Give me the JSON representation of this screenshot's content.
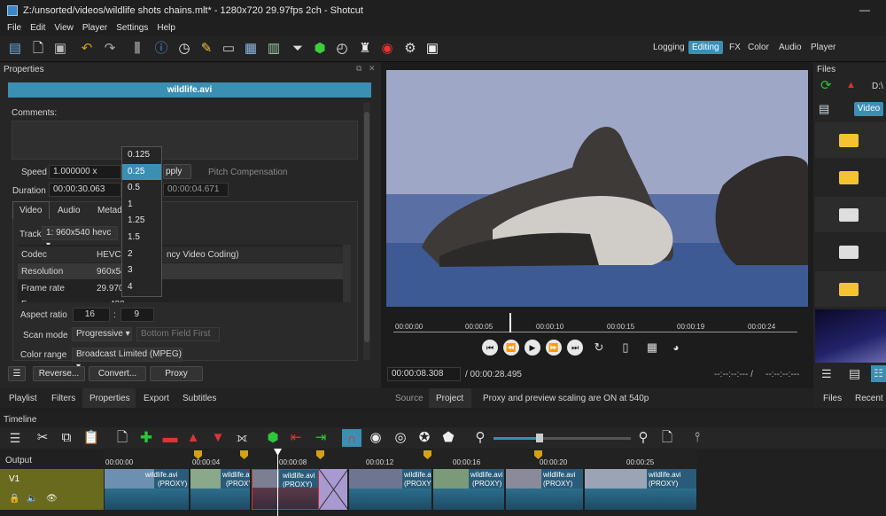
{
  "window": {
    "title": "Z:/unsorted/videos/wildlife shots chains.mlt* - 1280x720 29.97fps 2ch - Shotcut"
  },
  "menu": [
    "File",
    "Edit",
    "View",
    "Player",
    "Settings",
    "Help"
  ],
  "layouts": {
    "logging": "Logging",
    "editing": "Editing",
    "fx": "FX",
    "color": "Color",
    "audio": "Audio",
    "player": "Player"
  },
  "properties": {
    "header": "Properties",
    "clip_name": "wildlife.avi",
    "comments_label": "Comments:",
    "speed_label": "Speed",
    "speed_value": "1.000000 x",
    "apply_label": "pply",
    "pitch_label": "Pitch Compensation",
    "duration_label": "Duration",
    "duration_value": "00:00:30.063",
    "duration_value2": "00:00:04.671",
    "tabs": [
      "Video",
      "Audio",
      "Metada"
    ],
    "track_label": "Track",
    "track_value": "1: 960x540 hevc",
    "info_rows": [
      {
        "key": "Codec",
        "value": "HEVC (",
        "value2": "ncy Video Coding)"
      },
      {
        "key": "Resolution",
        "value": "960x54"
      },
      {
        "key": "Frame rate",
        "value": "29.9700"
      },
      {
        "key": "F",
        "value": "420"
      }
    ],
    "aspect_label": "Aspect ratio",
    "aspect_w": "16",
    "aspect_h": "9",
    "scan_label": "Scan mode",
    "scan_value": "Progressive",
    "field_value": "Bottom Field First",
    "color_range_label": "Color range",
    "color_range_value": "Broadcast Limited (MPEG)",
    "buttons": {
      "reverse": "Reverse...",
      "convert": "Convert...",
      "proxy": "Proxy"
    }
  },
  "speed_dropdown": [
    "0.125",
    "0.25",
    "0.5",
    "1",
    "1.25",
    "1.5",
    "2",
    "3",
    "4"
  ],
  "speed_selected": "0.25",
  "left_tabs": [
    "Playlist",
    "Filters",
    "Properties",
    "Export",
    "Subtitles"
  ],
  "player": {
    "ruler": [
      "00:00:00",
      "00:00:05",
      "00:00:10",
      "00:00:15",
      "00:00:19",
      "00:00:24"
    ],
    "timecode": "00:00:08.308",
    "duration": "/ 00:00:28.495",
    "in_point": "--:--:--:--- /",
    "out_point": "--:--:--:---",
    "tabs": [
      "Source",
      "Project"
    ],
    "status": "Proxy and preview scaling are ON at 540p"
  },
  "files": {
    "header": "Files",
    "path": "D:\\",
    "filter": "Video",
    "tabs": [
      "Files",
      "Recent"
    ]
  },
  "timeline": {
    "header": "Timeline",
    "output_label": "Output",
    "track_name": "V1",
    "ruler": [
      "00:00:00",
      "00:00:04",
      "00:00:08",
      "00:00:12",
      "00:00:16",
      "00:00:20",
      "00:00:25"
    ],
    "clip_name": "wildlife.avi",
    "proxy_tag": "(PROXY)"
  },
  "icons": [
    "open-icon",
    "new-icon",
    "save-icon",
    "undo-icon",
    "redo-icon",
    "mixer-icon",
    "info-icon",
    "history-icon",
    "notes-icon",
    "timeline-icon",
    "playlist-icon",
    "filter-icon",
    "funnel-icon",
    "markers-icon",
    "keyframes-icon",
    "chess-icon",
    "record-icon",
    "settings-icon",
    "export-icon"
  ]
}
